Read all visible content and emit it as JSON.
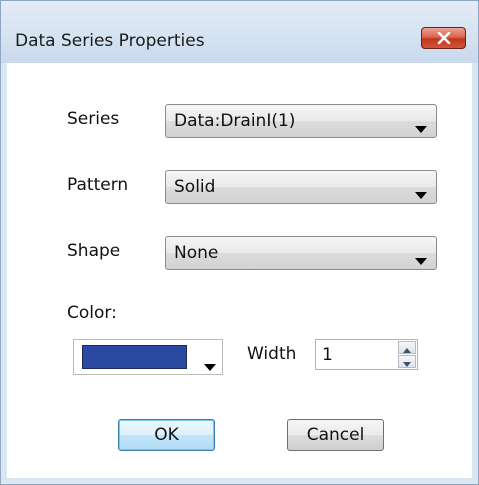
{
  "window": {
    "title": "Data Series Properties",
    "close_icon": "close-icon"
  },
  "form": {
    "series": {
      "label": "Series",
      "value": "Data:DrainI(1)"
    },
    "pattern": {
      "label": "Pattern",
      "value": "Solid"
    },
    "shape": {
      "label": "Shape",
      "value": "None"
    },
    "color": {
      "label": "Color:",
      "swatch_hex": "#2b49a0"
    },
    "width": {
      "label": "Width",
      "value": "1"
    }
  },
  "buttons": {
    "ok_label": "OK",
    "cancel_label": "Cancel"
  },
  "colors": {
    "close_button": "#c1361d",
    "ok_button_border": "#3c7fb1",
    "window_frame": "#dbe6f3"
  }
}
